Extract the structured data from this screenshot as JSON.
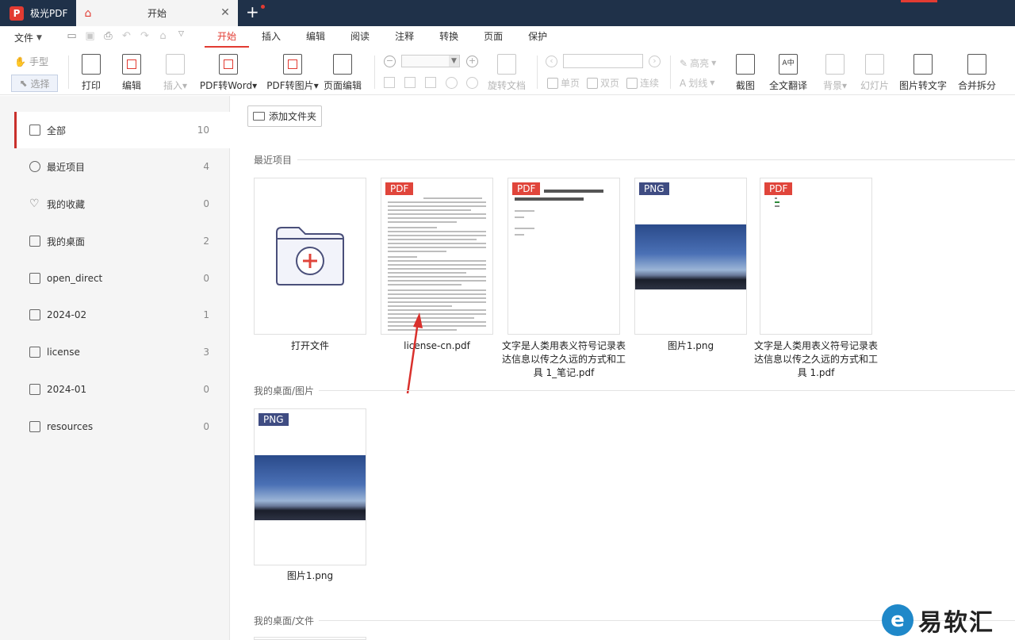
{
  "titlebar": {
    "app_name": "极光PDF",
    "logo_letter": "P",
    "tab_label": "开始",
    "close_glyph": "✕",
    "new_tab_glyph": "+"
  },
  "menubar": {
    "file_label": "文件",
    "items": [
      "开始",
      "插入",
      "编辑",
      "阅读",
      "注释",
      "转换",
      "页面",
      "保护"
    ],
    "active_index": 0
  },
  "ribbon": {
    "hand_tool": "手型",
    "select_tool": "选择",
    "print": "打印",
    "edit": "编辑",
    "insert": "插入",
    "pdf_to_word": "PDF转Word",
    "pdf_to_image": "PDF转图片",
    "page_edit": "页面编辑",
    "rotate_doc": "旋转文档",
    "single_page": "单页",
    "double_page": "双页",
    "continuous": "连续",
    "highlight": "高亮",
    "strikethrough": "划线",
    "screenshot": "截图",
    "full_translate": "全文翻译",
    "background": "背景",
    "slideshow": "幻灯片",
    "image_to_text": "图片转文字",
    "merge_split": "合并拆分",
    "translate_icon_glyph": "A中"
  },
  "sidebar": {
    "items": [
      {
        "label": "全部",
        "count": "10",
        "icon": "grid-icon"
      },
      {
        "label": "最近项目",
        "count": "4",
        "icon": "clock-icon"
      },
      {
        "label": "我的收藏",
        "count": "0",
        "icon": "heart-icon"
      },
      {
        "label": "我的桌面",
        "count": "2",
        "icon": "desktop-icon"
      },
      {
        "label": "open_direct",
        "count": "0",
        "icon": "folder-icon"
      },
      {
        "label": "2024-02",
        "count": "1",
        "icon": "folder-icon"
      },
      {
        "label": "license",
        "count": "3",
        "icon": "folder-icon"
      },
      {
        "label": "2024-01",
        "count": "0",
        "icon": "folder-icon"
      },
      {
        "label": "resources",
        "count": "0",
        "icon": "folder-icon"
      }
    ]
  },
  "content": {
    "add_folder": "添加文件夹",
    "sections": [
      {
        "title": "最近项目"
      },
      {
        "title": "我的桌面/图片"
      },
      {
        "title": "我的桌面/文件"
      }
    ],
    "recent_cards": [
      {
        "label": "打开文件",
        "badge": ""
      },
      {
        "label": "license-cn.pdf",
        "badge": "PDF"
      },
      {
        "label": "文字是人类用表义符号记录表达信息以传之久远的方式和工具 1_笔记.pdf",
        "badge": "PDF"
      },
      {
        "label": "图片1.png",
        "badge": "PNG"
      },
      {
        "label": "文字是人类用表义符号记录表达信息以传之久远的方式和工具 1.pdf",
        "badge": "PDF"
      }
    ],
    "desktop_image_cards": [
      {
        "label": "图片1.png",
        "badge": "PNG"
      }
    ]
  },
  "watermark": {
    "text": "易软汇",
    "logo_glyph": "e"
  },
  "colors": {
    "titlebar": "#1f3149",
    "accent": "#e23b32",
    "png_badge": "#3f4c82"
  }
}
